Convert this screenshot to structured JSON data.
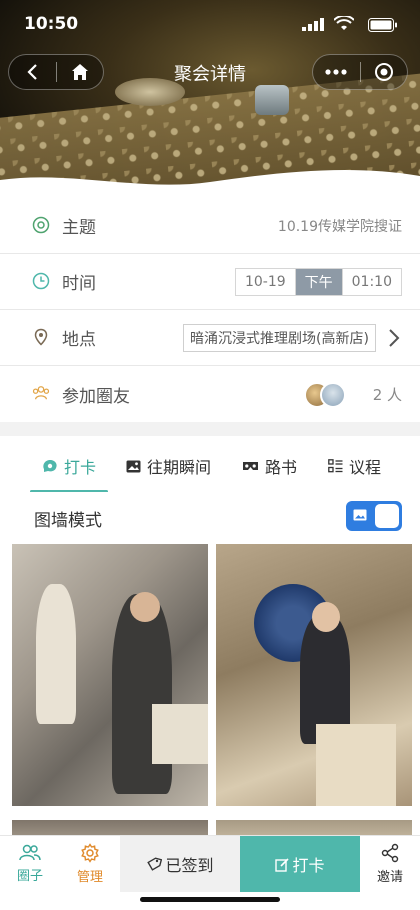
{
  "status": {
    "time": "10:50"
  },
  "nav": {
    "title": "聚会详情"
  },
  "info": {
    "topic_label": "主题",
    "topic_value": "10.19传媒学院搜证",
    "time_label": "时间",
    "time_date": "10-19",
    "time_period": "下午",
    "time_clock": "01:10",
    "place_label": "地点",
    "place_value": "暗涌沉浸式推理剧场(高新店)",
    "members_label": "参加圈友",
    "members_count": "2 人"
  },
  "tabs": [
    {
      "label": "打卡",
      "icon": "checkin-icon",
      "active": true
    },
    {
      "label": "往期瞬间",
      "icon": "image-icon",
      "active": false
    },
    {
      "label": "路书",
      "icon": "vr-glasses-icon",
      "active": false
    },
    {
      "label": "议程",
      "icon": "list-icon",
      "active": false
    }
  ],
  "mode": {
    "label": "图墙模式",
    "enabled": true
  },
  "bottom": {
    "circle_label": "圈子",
    "manage_label": "管理",
    "signed_label": "已签到",
    "checkin_label": "打卡",
    "invite_label": "邀请"
  },
  "colors": {
    "accent": "#4fb7ab",
    "manage": "#e08a2b",
    "toggle": "#2f7de0",
    "time_active": "#8e9aa6"
  }
}
